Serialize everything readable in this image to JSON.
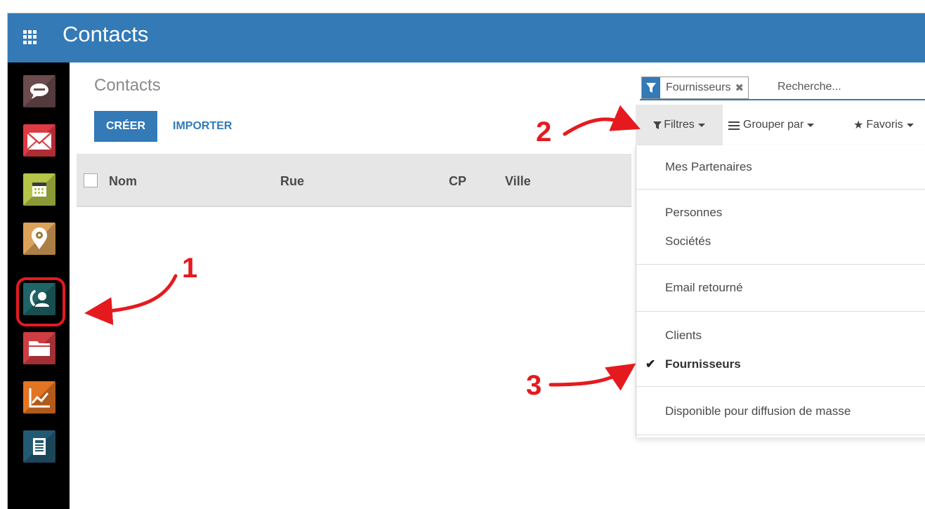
{
  "app": {
    "title": "Contacts"
  },
  "sidebar": {
    "items": [
      {
        "name": "discuss",
        "icon": "chat-bubble-icon",
        "color": "#5b3f41"
      },
      {
        "name": "mail",
        "icon": "envelope-icon",
        "color": "#d6303a"
      },
      {
        "name": "calendar",
        "icon": "calendar-icon",
        "color": "#a6b93c"
      },
      {
        "name": "location",
        "icon": "map-pin-icon",
        "color": "#d49a4a"
      },
      {
        "name": "contacts",
        "icon": "contact-phone-icon",
        "color": "#1c5c5e",
        "selected": true
      },
      {
        "name": "documents",
        "icon": "folder-icon",
        "color": "#c8363a"
      },
      {
        "name": "reporting",
        "icon": "chart-line-icon",
        "color": "#e06a18"
      },
      {
        "name": "news",
        "icon": "newspaper-icon",
        "color": "#1d4f66"
      }
    ]
  },
  "main": {
    "breadcrumb": "Contacts",
    "buttons": {
      "create": "CRÉER",
      "import": "IMPORTER"
    },
    "table": {
      "columns": [
        "Nom",
        "Rue",
        "CP",
        "Ville"
      ]
    }
  },
  "search": {
    "facet": "Fournisseurs",
    "facet_remove": "✖",
    "placeholder": "Recherche..."
  },
  "searchview": {
    "filters": "Filtres",
    "group_by": "Grouper par",
    "favorites": "Favoris"
  },
  "filters_menu": [
    {
      "label": "Mes Partenaires",
      "checked": false
    },
    {
      "label": "Personnes",
      "checked": false
    },
    {
      "label": "Sociétés",
      "checked": false
    },
    {
      "label": "Email retourné",
      "checked": false
    },
    {
      "label": "Clients",
      "checked": false
    },
    {
      "label": "Fournisseurs",
      "checked": true
    },
    {
      "label": "Disponible pour diffusion de masse",
      "checked": false
    }
  ],
  "annotations": {
    "step1": "1",
    "step2": "2",
    "step3": "3"
  },
  "colors": {
    "brand": "#337ab7",
    "annotation": "#e51a1f"
  }
}
